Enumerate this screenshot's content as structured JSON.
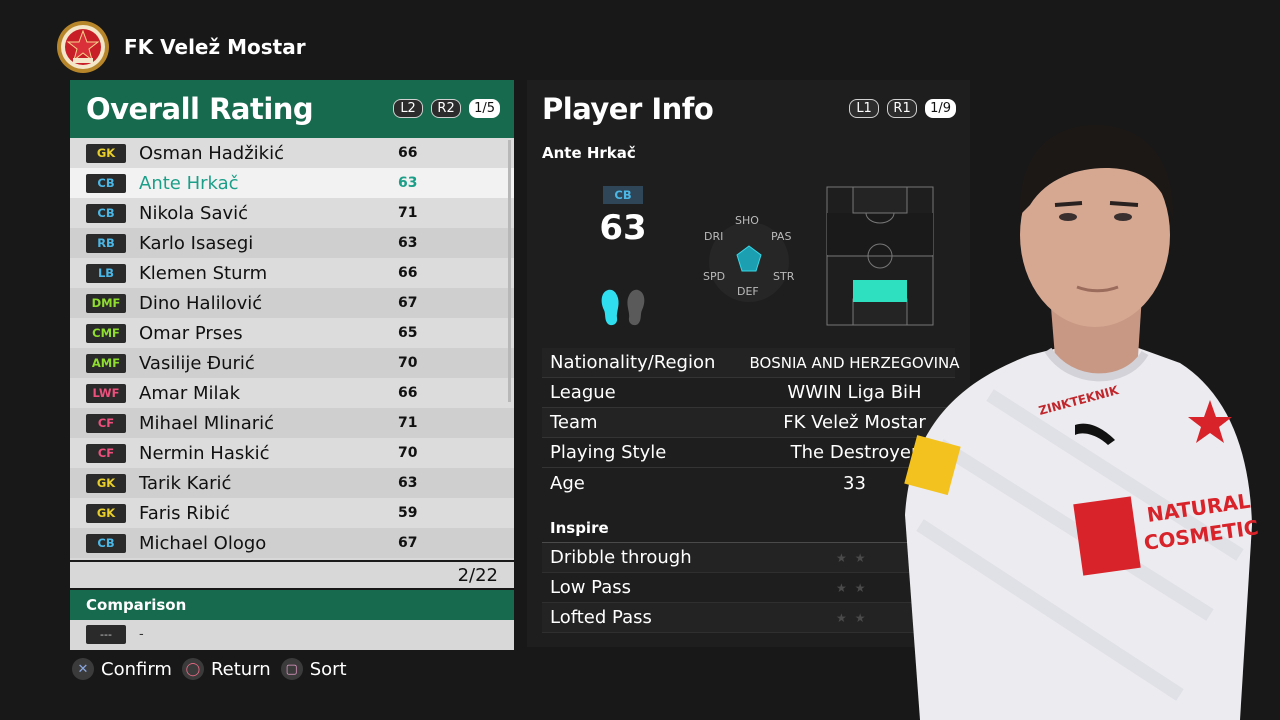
{
  "header": {
    "club_name": "FK Velež Mostar"
  },
  "left_panel": {
    "title": "Overall Rating",
    "buttons": [
      "L2",
      "R2"
    ],
    "page": "1/5",
    "players": [
      {
        "pos": "GK",
        "name": "Osman Hadžikić",
        "rating": "66"
      },
      {
        "pos": "CB",
        "name": "Ante Hrkač",
        "rating": "63"
      },
      {
        "pos": "CB",
        "name": "Nikola Savić",
        "rating": "71"
      },
      {
        "pos": "RB",
        "name": "Karlo Isasegi",
        "rating": "63"
      },
      {
        "pos": "LB",
        "name": "Klemen Sturm",
        "rating": "66"
      },
      {
        "pos": "DMF",
        "name": "Dino Halilović",
        "rating": "67"
      },
      {
        "pos": "CMF",
        "name": "Omar Prses",
        "rating": "65"
      },
      {
        "pos": "AMF",
        "name": "Vasilije Đurić",
        "rating": "70"
      },
      {
        "pos": "LWF",
        "name": "Amar Milak",
        "rating": "66"
      },
      {
        "pos": "CF",
        "name": "Mihael Mlinarić",
        "rating": "71"
      },
      {
        "pos": "CF",
        "name": "Nermin Haskić",
        "rating": "70"
      },
      {
        "pos": "GK",
        "name": "Tarik Karić",
        "rating": "63"
      },
      {
        "pos": "GK",
        "name": "Faris Ribić",
        "rating": "59"
      },
      {
        "pos": "CB",
        "name": "Michael Ologo",
        "rating": "67"
      }
    ],
    "selected_index": 1,
    "list_position": "2/22",
    "comparison": {
      "title": "Comparison",
      "badge": "---",
      "value": "-"
    }
  },
  "right_panel": {
    "title": "Player Info",
    "buttons": [
      "L1",
      "R1"
    ],
    "page": "1/9",
    "player_name": "Ante Hrkač",
    "position": "CB",
    "overall": "63",
    "radar_labels": {
      "sho": "SHO",
      "pas": "PAS",
      "str": "STR",
      "def": "DEF",
      "spd": "SPD",
      "dri": "DRI"
    },
    "info": [
      {
        "key": "Nationality/Region",
        "value": "BOSNIA AND HERZEGOVINA"
      },
      {
        "key": "League",
        "value": "WWIN Liga BiH"
      },
      {
        "key": "Team",
        "value": "FK Velež Mostar"
      },
      {
        "key": "Playing Style",
        "value": "The Destroyer"
      },
      {
        "key": "Age",
        "value": "33"
      }
    ],
    "inspire_title": "Inspire",
    "inspire": [
      {
        "key": "Dribble through",
        "stars": "★★"
      },
      {
        "key": "Low Pass",
        "stars": "★★"
      },
      {
        "key": "Lofted Pass",
        "stars": "★★"
      }
    ]
  },
  "bottom_bar": {
    "confirm": "Confirm",
    "return": "Return",
    "sort": "Sort"
  },
  "colors": {
    "accent_green": "#176a4e",
    "selected_text": "#1c9f89",
    "teal": "#2fe0c0"
  },
  "icons": [
    "club-crest-icon",
    "feet-icon",
    "radar-chart-icon",
    "pitch-position-icon",
    "cross-button-icon",
    "circle-button-icon",
    "square-button-icon"
  ]
}
